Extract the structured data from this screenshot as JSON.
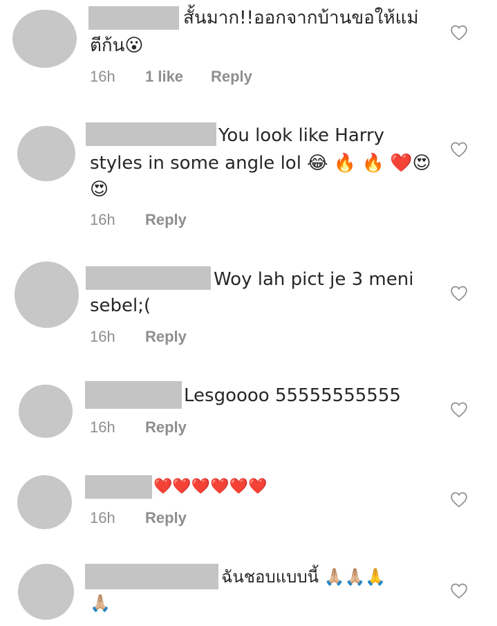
{
  "comments": [
    {
      "line1": "สั้นมาก!!ออกจากบ้านขอให้แม่",
      "line2": "ตีก้น😮",
      "time": "16h",
      "likes": "1 like",
      "reply": "Reply"
    },
    {
      "line1": "You look like Harry",
      "line2": "styles in some angle lol 😂 🔥 🔥 ❤️😍",
      "line3": "😍",
      "time": "16h",
      "reply": "Reply"
    },
    {
      "line1": "Woy lah pict je 3 meni",
      "line2": "sebel;(",
      "time": "16h",
      "reply": "Reply"
    },
    {
      "line1": "Lesgoooo 55555555555",
      "time": "16h",
      "reply": "Reply"
    },
    {
      "line1": "❤️❤️❤️❤️❤️❤️",
      "time": "16h",
      "reply": "Reply"
    },
    {
      "line1": "ฉันชอบแบบนี้ 🙏🏼🙏🏼🙏",
      "line2": "🙏🏼"
    }
  ],
  "icons": {
    "heart": "heart-outline-icon"
  },
  "colors": {
    "avatar": "#c7c7c7",
    "redaction": "#c4c4c4",
    "meta": "#8e8e8e",
    "text": "#262626"
  }
}
